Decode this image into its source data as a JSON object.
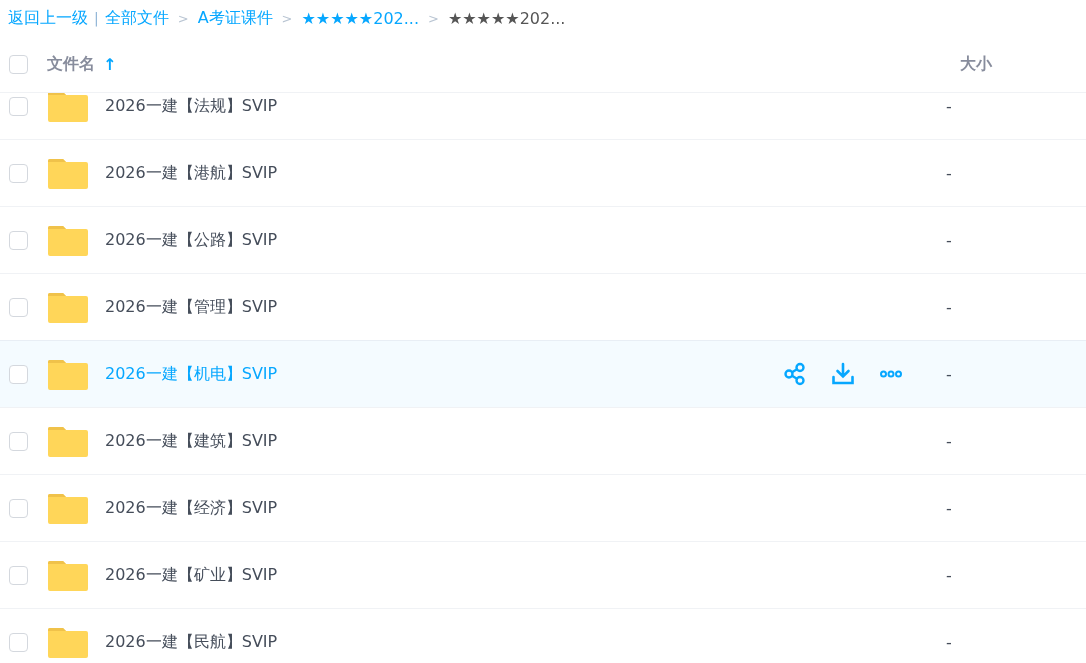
{
  "breadcrumb": [
    {
      "label": "返回上一级",
      "kind": "link"
    },
    {
      "label": "|",
      "kind": "bar"
    },
    {
      "label": "全部文件",
      "kind": "link"
    },
    {
      "label": ">",
      "kind": "sep"
    },
    {
      "label": "A考证课件",
      "kind": "link"
    },
    {
      "label": ">",
      "kind": "sep"
    },
    {
      "label": "★★★★★202...",
      "kind": "link"
    },
    {
      "label": ">",
      "kind": "sep"
    },
    {
      "label": "★★★★★202...",
      "kind": "current"
    }
  ],
  "header": {
    "checked": false,
    "name": "文件名",
    "sort_arrow": "↑",
    "size": "大小"
  },
  "rows": [
    {
      "name": "2026一建【法规】SVIP",
      "size": "-",
      "checked": false,
      "hovered": false
    },
    {
      "name": "2026一建【港航】SVIP",
      "size": "-",
      "checked": false,
      "hovered": false
    },
    {
      "name": "2026一建【公路】SVIP",
      "size": "-",
      "checked": false,
      "hovered": false
    },
    {
      "name": "2026一建【管理】SVIP",
      "size": "-",
      "checked": false,
      "hovered": false
    },
    {
      "name": "2026一建【机电】SVIP",
      "size": "-",
      "checked": false,
      "hovered": true
    },
    {
      "name": "2026一建【建筑】SVIP",
      "size": "-",
      "checked": false,
      "hovered": false
    },
    {
      "name": "2026一建【经济】SVIP",
      "size": "-",
      "checked": false,
      "hovered": false
    },
    {
      "name": "2026一建【矿业】SVIP",
      "size": "-",
      "checked": false,
      "hovered": false
    },
    {
      "name": "2026一建【民航】SVIP",
      "size": "-",
      "checked": false,
      "hovered": false
    }
  ]
}
